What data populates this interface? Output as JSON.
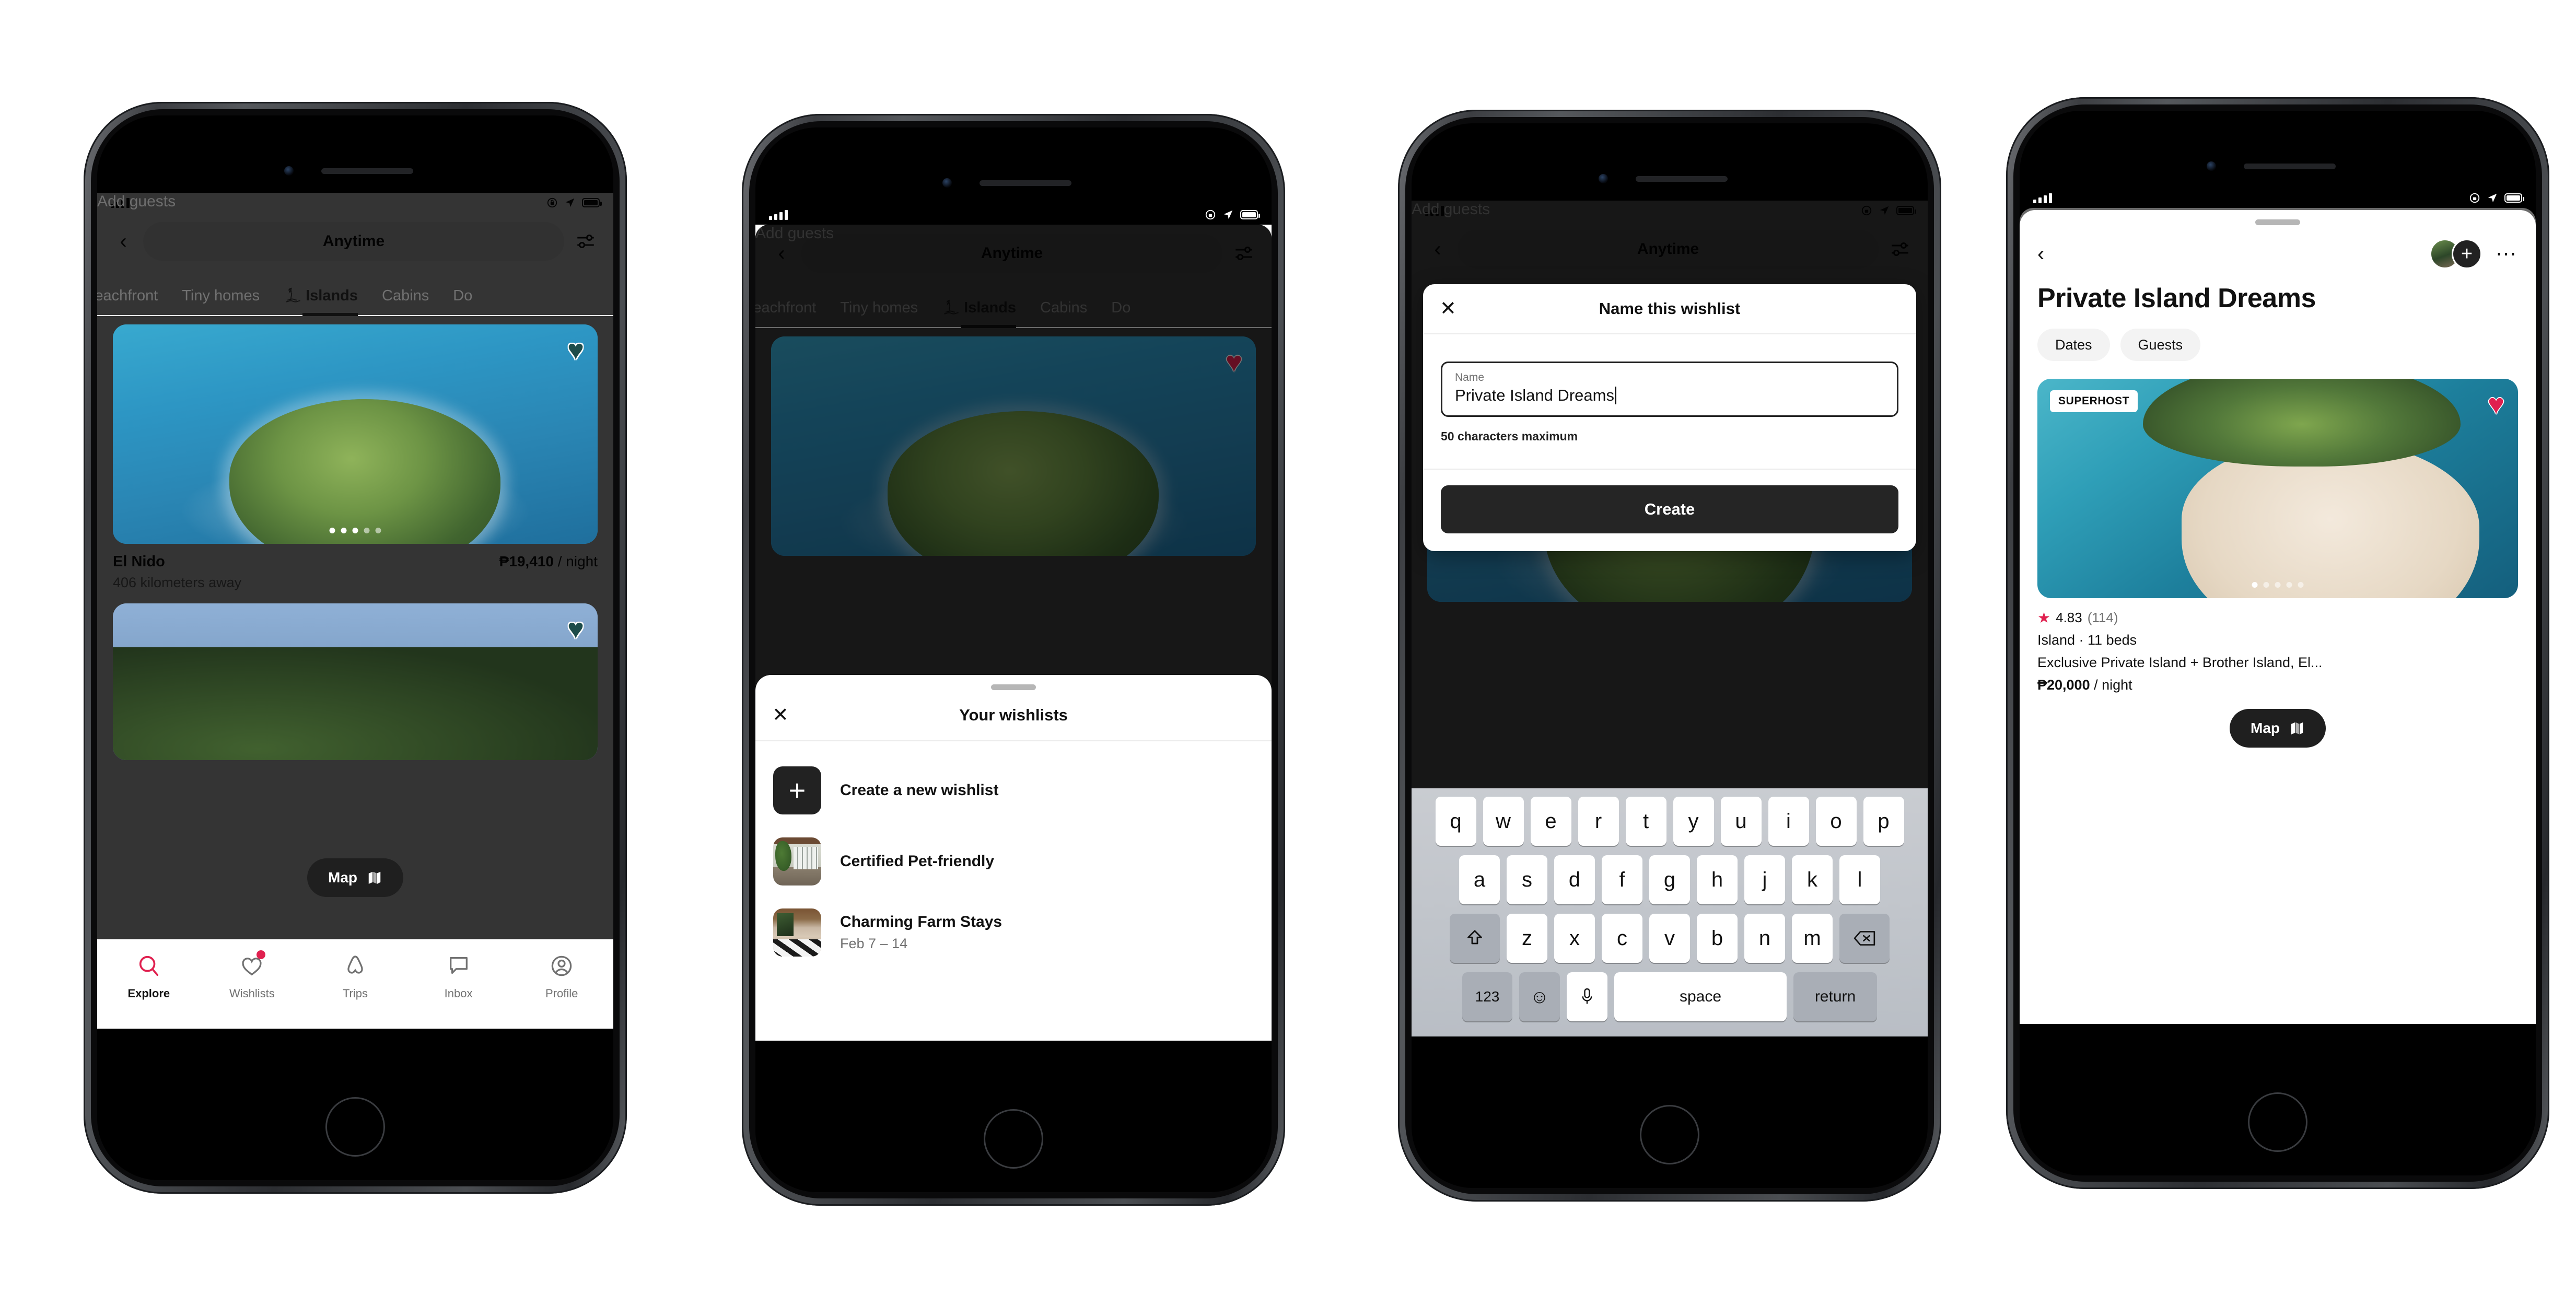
{
  "colors": {
    "accent": "#e0204f",
    "dark": "#222222",
    "muted": "#717171"
  },
  "statusbar": {
    "rotation_lock_icon": "rotation-lock-icon",
    "location_icon": "location-arrow-icon",
    "battery_icon": "battery-icon",
    "signal_icon": "signal-bars-icon"
  },
  "phone1": {
    "search": {
      "back_icon": "chevron-left-icon",
      "date_label": "Anytime",
      "separator": "·",
      "guests_label": "Add guests",
      "filter_icon": "filter-icon"
    },
    "categories": [
      {
        "label": "Beachfront",
        "icon": "",
        "active": false
      },
      {
        "label": "Tiny homes",
        "icon": "",
        "active": false
      },
      {
        "label": "Islands",
        "icon": "island-icon",
        "active": true
      },
      {
        "label": "Cabins",
        "icon": "",
        "active": false
      },
      {
        "label": "Do",
        "icon": "",
        "active": false
      }
    ],
    "listing": {
      "title": "El Nido",
      "price": "₱19,410",
      "price_unit": "/ night",
      "distance": "406 kilometers away",
      "heart_icon": "heart-filled-icon",
      "photo_dots": 5,
      "photo_dot_active": 0
    },
    "map_button": {
      "label": "Map",
      "icon": "map-icon"
    },
    "tabs": [
      {
        "label": "Explore",
        "icon": "search-icon",
        "active": true,
        "badge": false
      },
      {
        "label": "Wishlists",
        "icon": "heart-icon",
        "active": false,
        "badge": true
      },
      {
        "label": "Trips",
        "icon": "airbnb-bellhop-icon",
        "active": false,
        "badge": false
      },
      {
        "label": "Inbox",
        "icon": "message-icon",
        "active": false,
        "badge": false
      },
      {
        "label": "Profile",
        "icon": "profile-icon",
        "active": false,
        "badge": false
      }
    ]
  },
  "phone2": {
    "search": {
      "date_label": "Anytime",
      "separator": "·",
      "guests_label": "Add guests"
    },
    "categories": [
      "Beachfront",
      "Tiny homes",
      "Islands",
      "Cabins",
      "Do"
    ],
    "sheet": {
      "close_icon": "close-icon",
      "title": "Your wishlists",
      "items": [
        {
          "name": "Create a new wishlist",
          "sub": "",
          "thumb": "plus-icon"
        },
        {
          "name": "Certified Pet-friendly",
          "sub": "",
          "thumb": "pet-photo"
        },
        {
          "name": "Charming Farm Stays",
          "sub": "Feb 7 – 14",
          "thumb": "farm-photo"
        }
      ]
    }
  },
  "phone3": {
    "search": {
      "date_label": "Anytime",
      "separator": "·",
      "guests_label": "Add guests"
    },
    "modal": {
      "close_icon": "close-icon",
      "title": "Name this wishlist",
      "field_label": "Name",
      "field_value": "Private Island Dreams",
      "helper": "50 characters maximum",
      "submit_label": "Create"
    },
    "keyboard": {
      "row1": [
        "q",
        "w",
        "e",
        "r",
        "t",
        "y",
        "u",
        "i",
        "o",
        "p"
      ],
      "row2": [
        "a",
        "s",
        "d",
        "f",
        "g",
        "h",
        "j",
        "k",
        "l"
      ],
      "row3": [
        "z",
        "x",
        "c",
        "v",
        "b",
        "n",
        "m"
      ],
      "shift_icon": "shift-icon",
      "backspace_icon": "backspace-icon",
      "numbers_label": "123",
      "emoji_icon": "emoji-icon",
      "mic_icon": "microphone-icon",
      "space_label": "space",
      "return_label": "return"
    }
  },
  "phone4": {
    "header": {
      "back_icon": "chevron-left-icon",
      "avatar_icon": "avatar",
      "add_icon": "add-person-icon",
      "more_icon": "more-options-icon"
    },
    "title": "Private Island Dreams",
    "chips": [
      "Dates",
      "Guests"
    ],
    "listing": {
      "badge": "SUPERHOST",
      "heart_icon": "heart-filled-icon",
      "rating": "4.83",
      "review_count": "(114)",
      "type": "Island · 11 beds",
      "name": "Exclusive Private Island + Brother Island, El...",
      "price": "₱20,000",
      "price_unit": "/ night",
      "photo_dots": 5,
      "photo_dot_active": 0
    },
    "map_button": {
      "label": "Map",
      "icon": "map-icon"
    }
  }
}
